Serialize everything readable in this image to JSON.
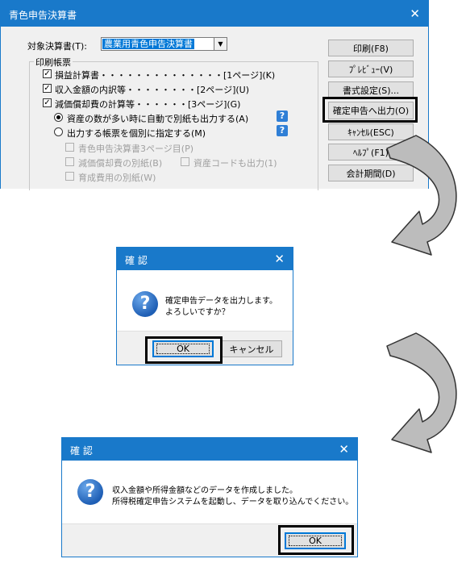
{
  "main_window": {
    "title": "青色申告決算書",
    "close_glyph": "✕",
    "target_label": "対象決算書(T):",
    "target_value": "農業用青色申告決算書",
    "group_label": "印刷帳票",
    "items": [
      {
        "label": "損益計算書・・・・・・・・・・・・・・[1ページ](K)",
        "checked": true
      },
      {
        "label": "収入金額の内訳等・・・・・・・・[2ページ](U)",
        "checked": true
      },
      {
        "label": "減価償却費の計算等・・・・・・[3ページ](G)",
        "checked": true
      }
    ],
    "radio_auto": "資産の数が多い時に自動で別紙も出力する(A)",
    "radio_manual": "出力する帳票を個別に指定する(M)",
    "help_glyph": "?",
    "sub_items": [
      "青色申告決算書3ページ目(P)",
      "減価償却費の別紙(B)",
      "資産コードも出力(1)",
      "育成費用の別紙(W)"
    ],
    "buttons": {
      "print": "印刷(F8)",
      "preview": "ﾌﾟﾚﾋﾞｭｰ(V)",
      "format": "書式設定(S)...",
      "export": "確定申告へ出力(O)",
      "cancel": "ｷｬﾝｾﾙ(ESC)",
      "help": "ﾍﾙﾌﾟ(F1)",
      "period": "会計期間(D)"
    }
  },
  "confirm_dialog": {
    "title": "確 認",
    "close_glyph": "✕",
    "icon_glyph": "?",
    "line1": "確定申告データを出力します。",
    "line2": "よろしいですか？",
    "ok": "OK",
    "cancel": "キャンセル"
  },
  "result_dialog": {
    "title": "確 認",
    "close_glyph": "✕",
    "icon_glyph": "?",
    "line1": "収入金額や所得金額などのデータを作成しました。",
    "line2": "所得税確定申告システムを起動し、データを取り込んでください。",
    "ok": "OK"
  }
}
